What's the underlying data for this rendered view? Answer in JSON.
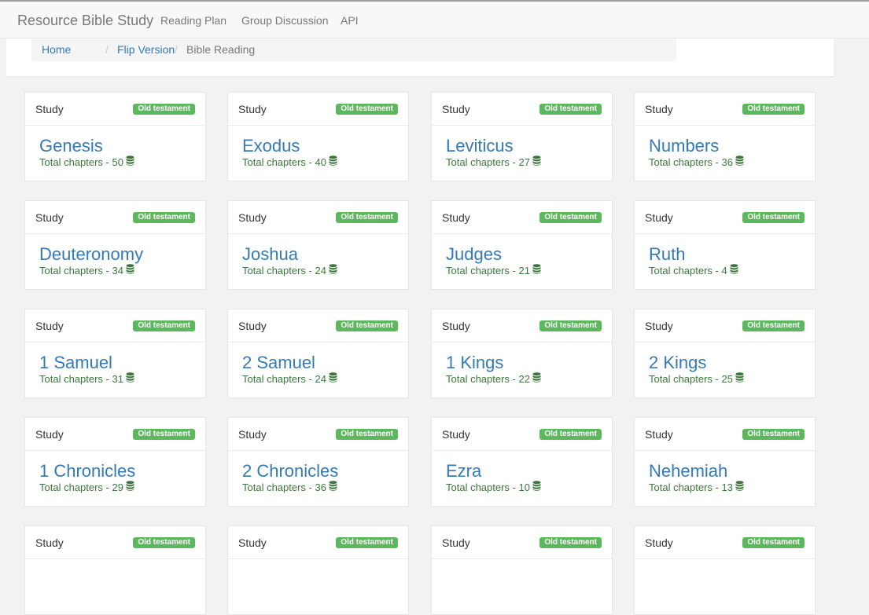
{
  "header": {
    "brand": "Resource Bible Study",
    "nav": [
      "Reading Plan",
      "Group Discussion",
      "API"
    ]
  },
  "breadcrumb": {
    "items": [
      "Home",
      "Flip Version"
    ],
    "active": "Bible Reading",
    "separator": "/"
  },
  "colors": {
    "link": "#337ab7",
    "badge": "#5cb85c",
    "chapters_text": "#3c763d"
  },
  "cards": [
    {
      "label": "Study",
      "badge": "Old testament",
      "book": "Genesis",
      "chapters_text": "Total chapters - 50"
    },
    {
      "label": "Study",
      "badge": "Old testament",
      "book": "Exodus",
      "chapters_text": "Total chapters - 40"
    },
    {
      "label": "Study",
      "badge": "Old testament",
      "book": "Leviticus",
      "chapters_text": "Total chapters - 27"
    },
    {
      "label": "Study",
      "badge": "Old testament",
      "book": "Numbers",
      "chapters_text": "Total chapters - 36"
    },
    {
      "label": "Study",
      "badge": "Old testament",
      "book": "Deuteronomy",
      "chapters_text": "Total chapters - 34"
    },
    {
      "label": "Study",
      "badge": "Old testament",
      "book": "Joshua",
      "chapters_text": "Total chapters - 24"
    },
    {
      "label": "Study",
      "badge": "Old testament",
      "book": "Judges",
      "chapters_text": "Total chapters - 21"
    },
    {
      "label": "Study",
      "badge": "Old testament",
      "book": "Ruth",
      "chapters_text": "Total chapters - 4"
    },
    {
      "label": "Study",
      "badge": "Old testament",
      "book": "1 Samuel",
      "chapters_text": "Total chapters - 31"
    },
    {
      "label": "Study",
      "badge": "Old testament",
      "book": "2 Samuel",
      "chapters_text": "Total chapters - 24"
    },
    {
      "label": "Study",
      "badge": "Old testament",
      "book": "1 Kings",
      "chapters_text": "Total chapters - 22"
    },
    {
      "label": "Study",
      "badge": "Old testament",
      "book": "2 Kings",
      "chapters_text": "Total chapters - 25"
    },
    {
      "label": "Study",
      "badge": "Old testament",
      "book": "1 Chronicles",
      "chapters_text": "Total chapters - 29"
    },
    {
      "label": "Study",
      "badge": "Old testament",
      "book": "2 Chronicles",
      "chapters_text": "Total chapters - 36"
    },
    {
      "label": "Study",
      "badge": "Old testament",
      "book": "Ezra",
      "chapters_text": "Total chapters - 10"
    },
    {
      "label": "Study",
      "badge": "Old testament",
      "book": "Nehemiah",
      "chapters_text": "Total chapters - 13"
    },
    {
      "label": "Study",
      "badge": "Old testament"
    },
    {
      "label": "Study",
      "badge": "Old testament"
    },
    {
      "label": "Study",
      "badge": "Old testament"
    },
    {
      "label": "Study",
      "badge": "Old testament"
    }
  ],
  "icons": {
    "chapters": "database-icon"
  }
}
